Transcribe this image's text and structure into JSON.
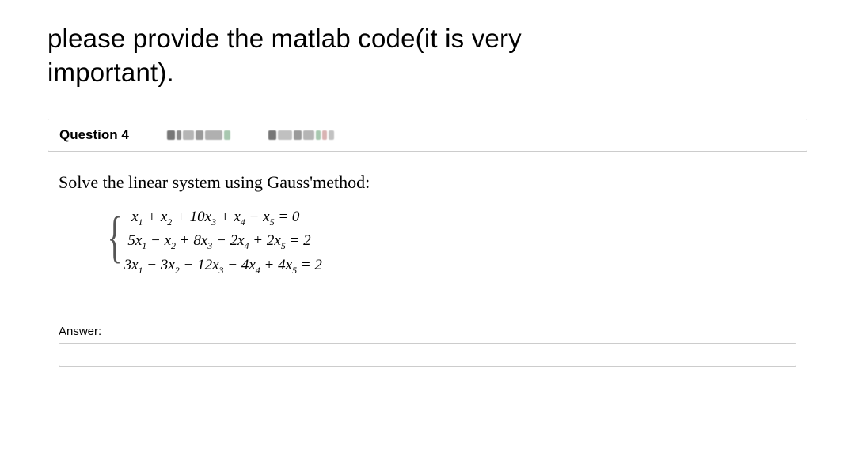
{
  "intro_line1": "please provide the matlab code(it is very",
  "intro_line2": "important).",
  "question": {
    "label": "Question 4",
    "prompt": "Solve the linear system using Gauss'method:",
    "equations": {
      "eq1": "x₁ + x₂ + 10x₃ + x₄ − x₅ = 0",
      "eq2": "5x₁ − x₂ + 8x₃ − 2x₄ + 2x₅ = 2",
      "eq3": "3x₁ − 3x₂ − 12x₃ − 4x₄ + 4x₅ = 2"
    }
  },
  "answer_label": "Answer:",
  "answer_value": ""
}
